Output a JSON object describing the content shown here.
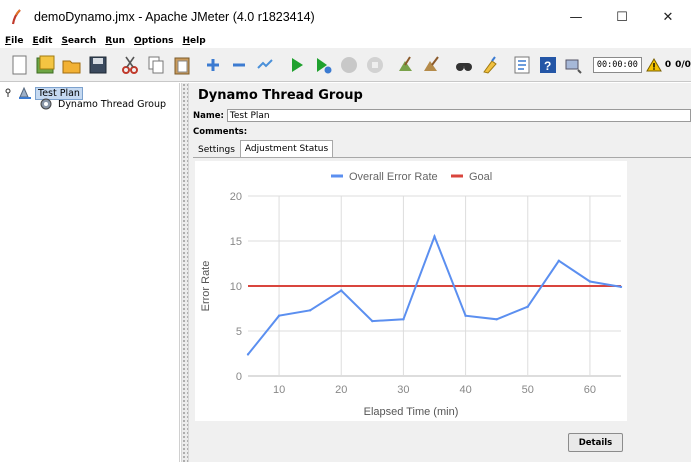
{
  "window": {
    "title": "demoDynamo.jmx - Apache JMeter (4.0 r1823414)",
    "minimize": "—",
    "maximize": "☐",
    "close": "✕"
  },
  "menu": [
    {
      "label": "File",
      "u": "F",
      "rest": "ile"
    },
    {
      "label": "Edit",
      "u": "E",
      "rest": "dit"
    },
    {
      "label": "Search",
      "u": "S",
      "rest": "earch"
    },
    {
      "label": "Run",
      "u": "R",
      "rest": "un"
    },
    {
      "label": "Options",
      "u": "O",
      "rest": "ptions"
    },
    {
      "label": "Help",
      "u": "H",
      "rest": "elp"
    }
  ],
  "toolbar": {
    "icons": [
      "new-icon",
      "templates-icon",
      "open-icon",
      "save-icon",
      "cut-icon",
      "copy-icon",
      "paste-icon",
      "expand-icon",
      "collapse-icon",
      "toggle-icon",
      "start-icon",
      "start-no-pause-icon",
      "stop-icon",
      "shutdown-icon",
      "clear-icon",
      "clear-all-icon",
      "search-icon",
      "reset-search-icon",
      "function-helper-icon",
      "help-icon",
      "remote-icon"
    ],
    "timer": "00:00:00",
    "warnings": "0",
    "threads": "0/0"
  },
  "tree": {
    "root": "Test Plan",
    "child": "Dynamo Thread Group"
  },
  "panel": {
    "title": "Dynamo Thread Group",
    "name_label": "Name:",
    "name_value": "Test Plan",
    "comments_label": "Comments:",
    "tabs": [
      "Settings",
      "Adjustment Status"
    ],
    "active_tab": "Adjustment Status",
    "details_button": "Details"
  },
  "colors": {
    "series_error": "#5b8ff0",
    "series_goal": "#d9453d",
    "grid": "#dddddd"
  },
  "chart_data": {
    "type": "line",
    "title": "",
    "xlabel": "Elapsed Time (min)",
    "ylabel": "Error Rate",
    "xlim": [
      5,
      65
    ],
    "ylim": [
      0,
      20
    ],
    "x_ticks": [
      10,
      20,
      30,
      40,
      50,
      60
    ],
    "y_ticks": [
      0,
      5,
      10,
      15,
      20
    ],
    "grid": true,
    "legend": "top-center",
    "series": [
      {
        "name": "Overall Error Rate",
        "color": "#5b8ff0",
        "x": [
          5,
          10,
          15,
          20,
          25,
          30,
          35,
          40,
          45,
          50,
          55,
          60,
          65
        ],
        "y": [
          2.4,
          6.7,
          7.3,
          9.5,
          6.1,
          6.3,
          15.5,
          6.7,
          6.3,
          7.7,
          12.8,
          10.5,
          9.9
        ]
      },
      {
        "name": "Goal",
        "color": "#d9453d",
        "x": [
          5,
          65
        ],
        "y": [
          10,
          10
        ]
      }
    ]
  }
}
